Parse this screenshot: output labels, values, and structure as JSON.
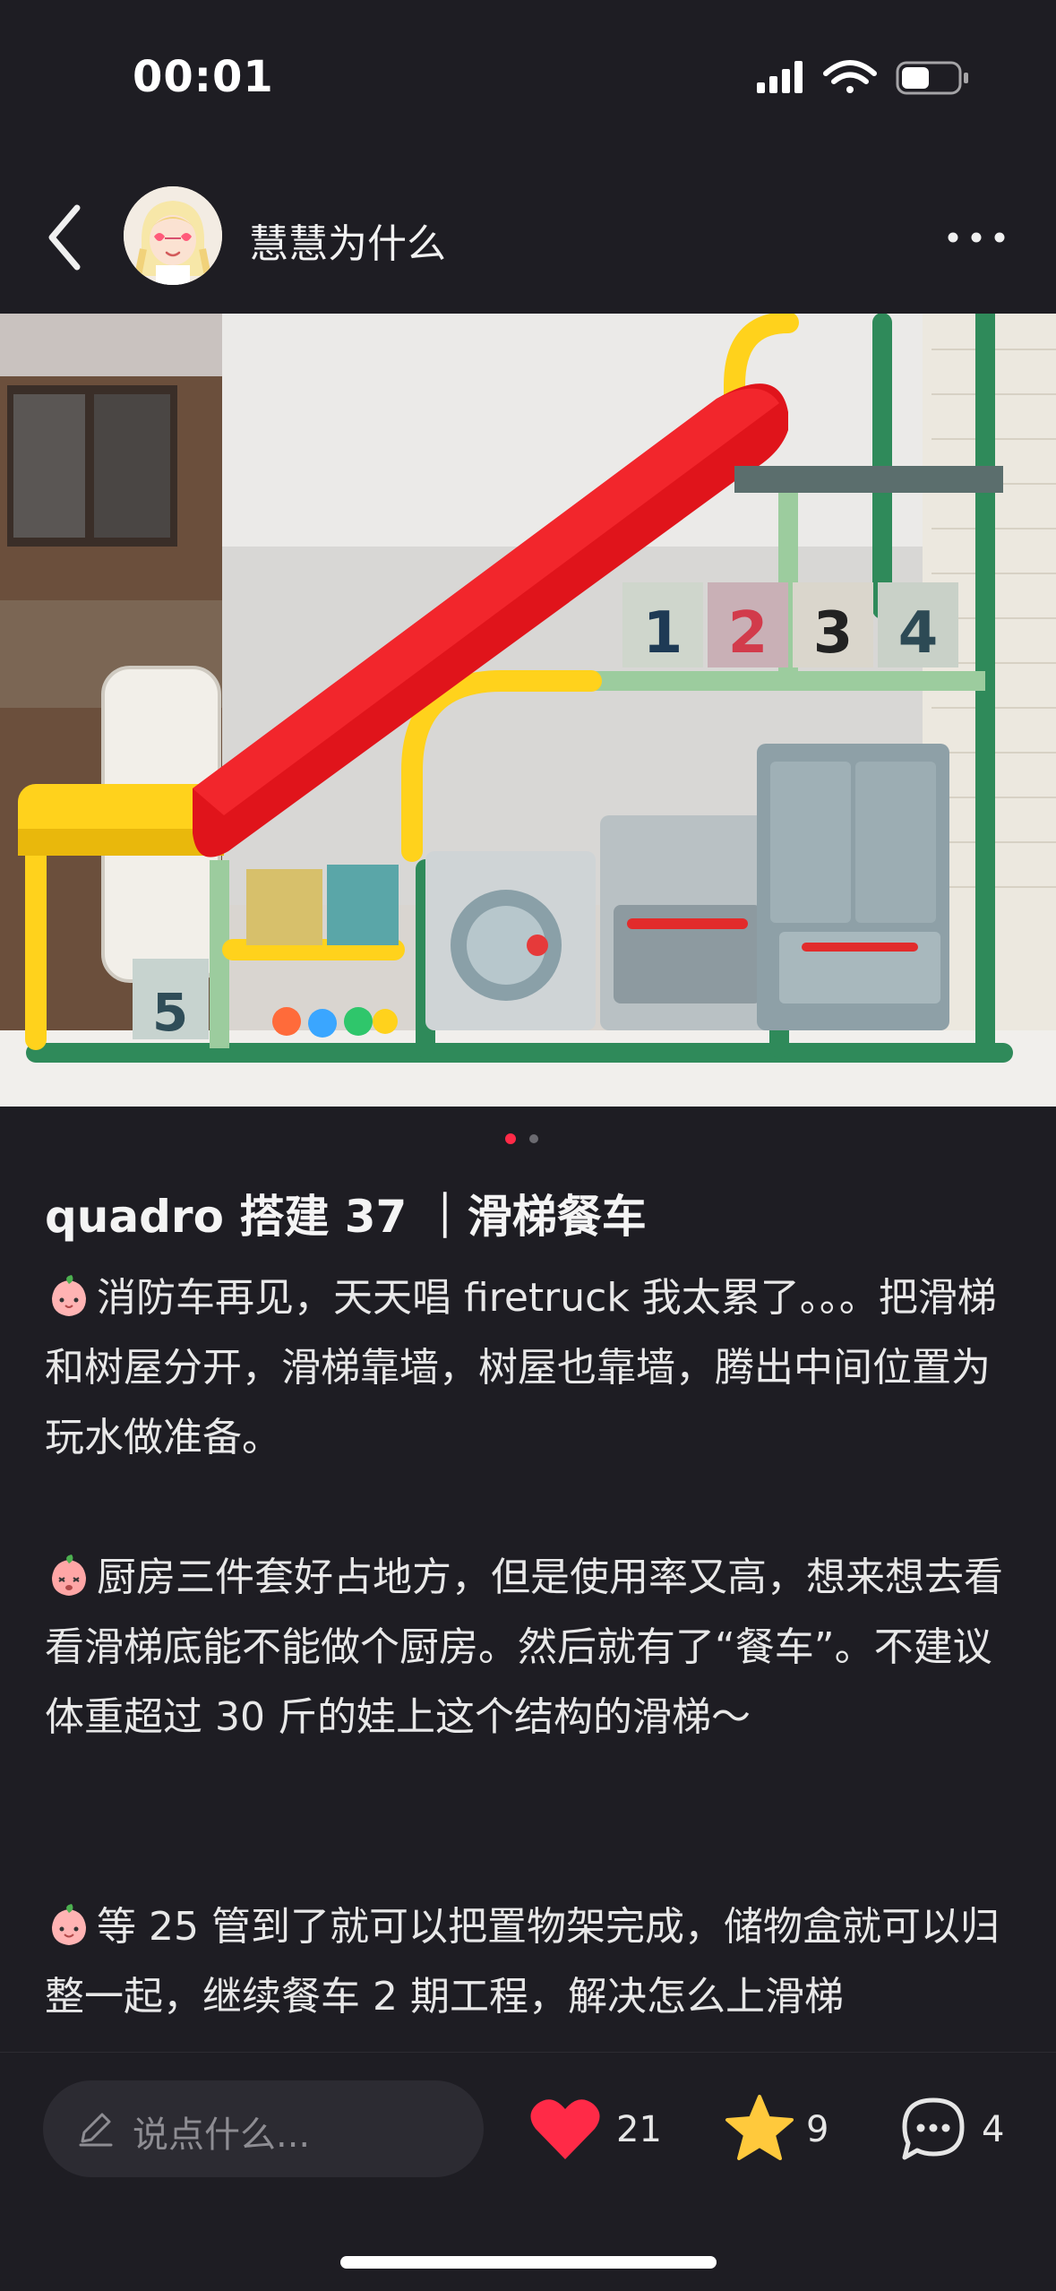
{
  "status_bar": {
    "time": "00:01"
  },
  "header": {
    "author_name": "慧慧为什么"
  },
  "carousel": {
    "page_count": 2,
    "active_index": 0
  },
  "post": {
    "title": "quadro 搭建 37 ｜滑梯餐车",
    "paragraphs": [
      "消防车再见，天天唱 firetruck 我太累了。。。把滑梯和树屋分开，滑梯靠墙，树屋也靠墙，腾出中间位置为玩水做准备。",
      "厨房三件套好占地方，但是使用率又高，想来想去看看滑梯底能不能做个厨房。然后就有了“餐车”。不建议体重超过 30 斤的娃上这个结构的滑梯～",
      "等 25 管到了就可以把置物架完成，储物盒就可以归整一起，继续餐车 2 期工程，解决怎么上滑梯"
    ]
  },
  "bottom_bar": {
    "comment_placeholder": "说点什么...",
    "likes": "21",
    "favorites": "9",
    "comments": "4"
  },
  "colors": {
    "like": "#ff2a47",
    "favorite": "#ffc93c",
    "accent_dot": "#ff2a47"
  }
}
